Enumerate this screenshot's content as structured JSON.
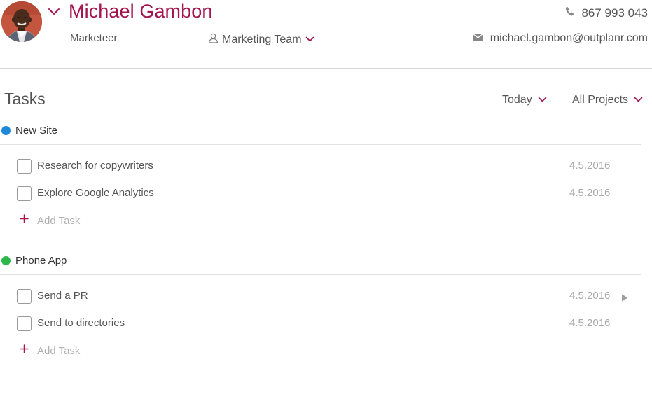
{
  "profile": {
    "name": "Michael Gambon",
    "role": "Marketeer",
    "team": "Marketing Team",
    "phone": "867 993 043",
    "email": "michael.gambon@outplanr.com"
  },
  "tasks_section": {
    "title": "Tasks",
    "filter_date": "Today",
    "filter_projects": "All Projects"
  },
  "projects": [
    {
      "name": "New Site",
      "color": "#1e88d9",
      "tasks": [
        {
          "title": "Research for copywriters",
          "date": "4.5.2016",
          "done": false
        },
        {
          "title": "Explore Google Analytics",
          "date": "4.5.2016",
          "done": false
        }
      ],
      "add_label": "Add Task"
    },
    {
      "name": "Phone App",
      "color": "#2eb84a",
      "tasks": [
        {
          "title": "Send a PR",
          "date": "4.5.2016",
          "done": false
        },
        {
          "title": "Send to directories",
          "date": "4.5.2016",
          "done": false
        }
      ],
      "add_label": "Add Task"
    }
  ],
  "colors": {
    "accent": "#a3154e",
    "text": "#555555",
    "muted": "#aaaaaa"
  }
}
